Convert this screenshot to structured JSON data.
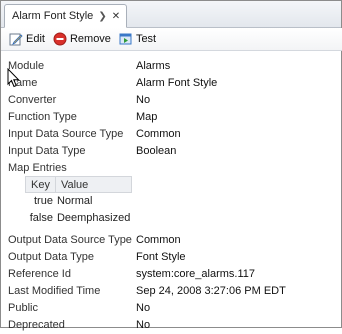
{
  "tab": {
    "title": "Alarm Font Style",
    "pin_icon": "pin-icon",
    "close_icon": "close-icon"
  },
  "toolbar": {
    "edit_label": "Edit",
    "remove_label": "Remove",
    "test_label": "Test"
  },
  "properties": [
    {
      "key": "Module",
      "value": "Alarms"
    },
    {
      "key": "Name",
      "value": "Alarm Font Style"
    },
    {
      "key": "Converter",
      "value": "No"
    },
    {
      "key": "Function Type",
      "value": "Map"
    },
    {
      "key": "Input Data Source Type",
      "value": "Common"
    },
    {
      "key": "Input Data Type",
      "value": "Boolean"
    },
    {
      "key": "Map Entries",
      "value": ""
    }
  ],
  "map_entries": {
    "headers": [
      "Key",
      "Value"
    ],
    "rows": [
      {
        "key": "true",
        "value": "Normal"
      },
      {
        "key": "false",
        "value": "Deemphasized"
      }
    ]
  },
  "properties_after": [
    {
      "key": "Output Data Source Type",
      "value": "Common"
    },
    {
      "key": "Output Data Type",
      "value": "Font Style"
    },
    {
      "key": "Reference Id",
      "value": "system:core_alarms.117"
    },
    {
      "key": "Last Modified Time",
      "value": "Sep 24, 2008 3:27:06 PM EDT"
    },
    {
      "key": "Public",
      "value": "No"
    },
    {
      "key": "Deprecated",
      "value": "No"
    }
  ],
  "colors": {
    "remove_red": "#d9302a",
    "edit_blue": "#2d6cc0",
    "test_blue": "#3a78c8"
  }
}
